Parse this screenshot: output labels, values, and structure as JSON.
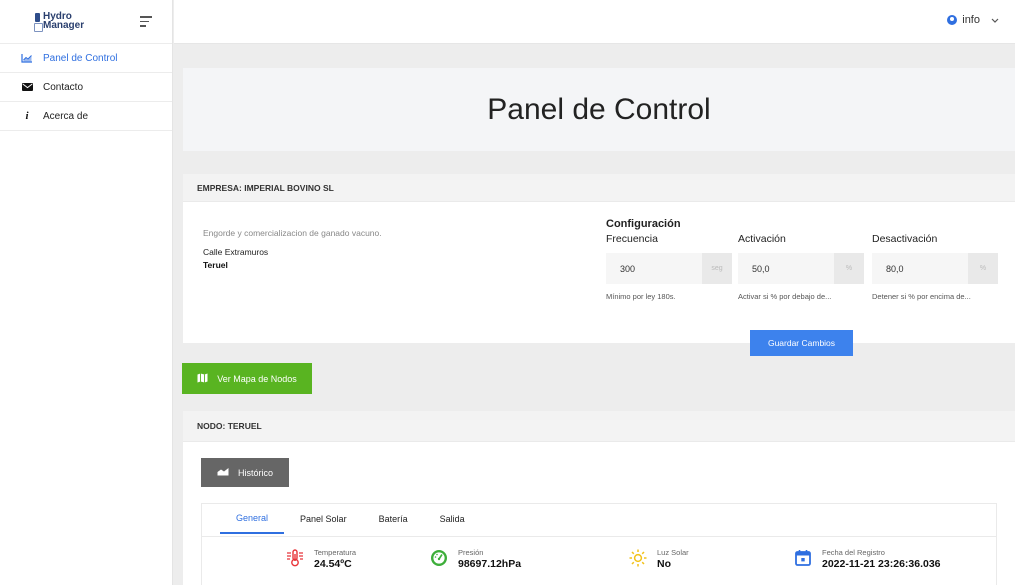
{
  "app": {
    "logo_line1": "Hydro",
    "logo_line2": "Manager"
  },
  "sidebar": {
    "items": [
      {
        "label": "Panel de Control",
        "icon": "chart-icon",
        "active": true
      },
      {
        "label": "Contacto",
        "icon": "envelope-icon",
        "active": false
      },
      {
        "label": "Acerca de",
        "icon": "info-icon",
        "active": false
      }
    ]
  },
  "topbar": {
    "user": "info"
  },
  "hero": {
    "title": "Panel de Control"
  },
  "company": {
    "header": "EMPRESA: IMPERIAL BOVINO SL",
    "description": "Engorde y comercializacion de ganado vacuno.",
    "address": "Calle Extramuros",
    "city": "Teruel"
  },
  "config": {
    "title": "Configuración",
    "frequency": {
      "label": "Frecuencia",
      "value": "300",
      "unit": "seg",
      "help": "Mínimo por ley 180s."
    },
    "activation": {
      "label": "Activación",
      "value": "50,0",
      "unit": "%",
      "help": "Activar si % por debajo de..."
    },
    "deactivation": {
      "label": "Desactivación",
      "value": "80,0",
      "unit": "%",
      "help": "Detener si % por encima de..."
    },
    "save_label": "Guardar Cambios"
  },
  "map_button": {
    "label": "Ver Mapa de Nodos"
  },
  "node": {
    "header": "NODO: TERUEL",
    "history_label": "Histórico",
    "tabs": [
      "General",
      "Panel Solar",
      "Batería",
      "Salida"
    ],
    "active_tab": "General",
    "stats": [
      {
        "label": "Temperatura",
        "value": "24.54ºC",
        "icon": "thermometer-icon"
      },
      {
        "label": "Presión",
        "value": "98697.12hPa",
        "icon": "gauge-icon"
      },
      {
        "label": "Luz Solar",
        "value": "No",
        "icon": "sun-icon"
      },
      {
        "label": "Fecha del Registro",
        "value": "2022-11-21 23:26:36.036",
        "icon": "calendar-icon"
      }
    ]
  },
  "colors": {
    "accent": "#2f6fe0",
    "save_button": "#3d82ed",
    "map_button": "#59b421",
    "history_button": "#666666",
    "temperature_icon": "#e8353a",
    "gauge_icon": "#3dae3a",
    "sun_icon": "#f2c21b",
    "calendar_icon": "#2f6fe0"
  }
}
